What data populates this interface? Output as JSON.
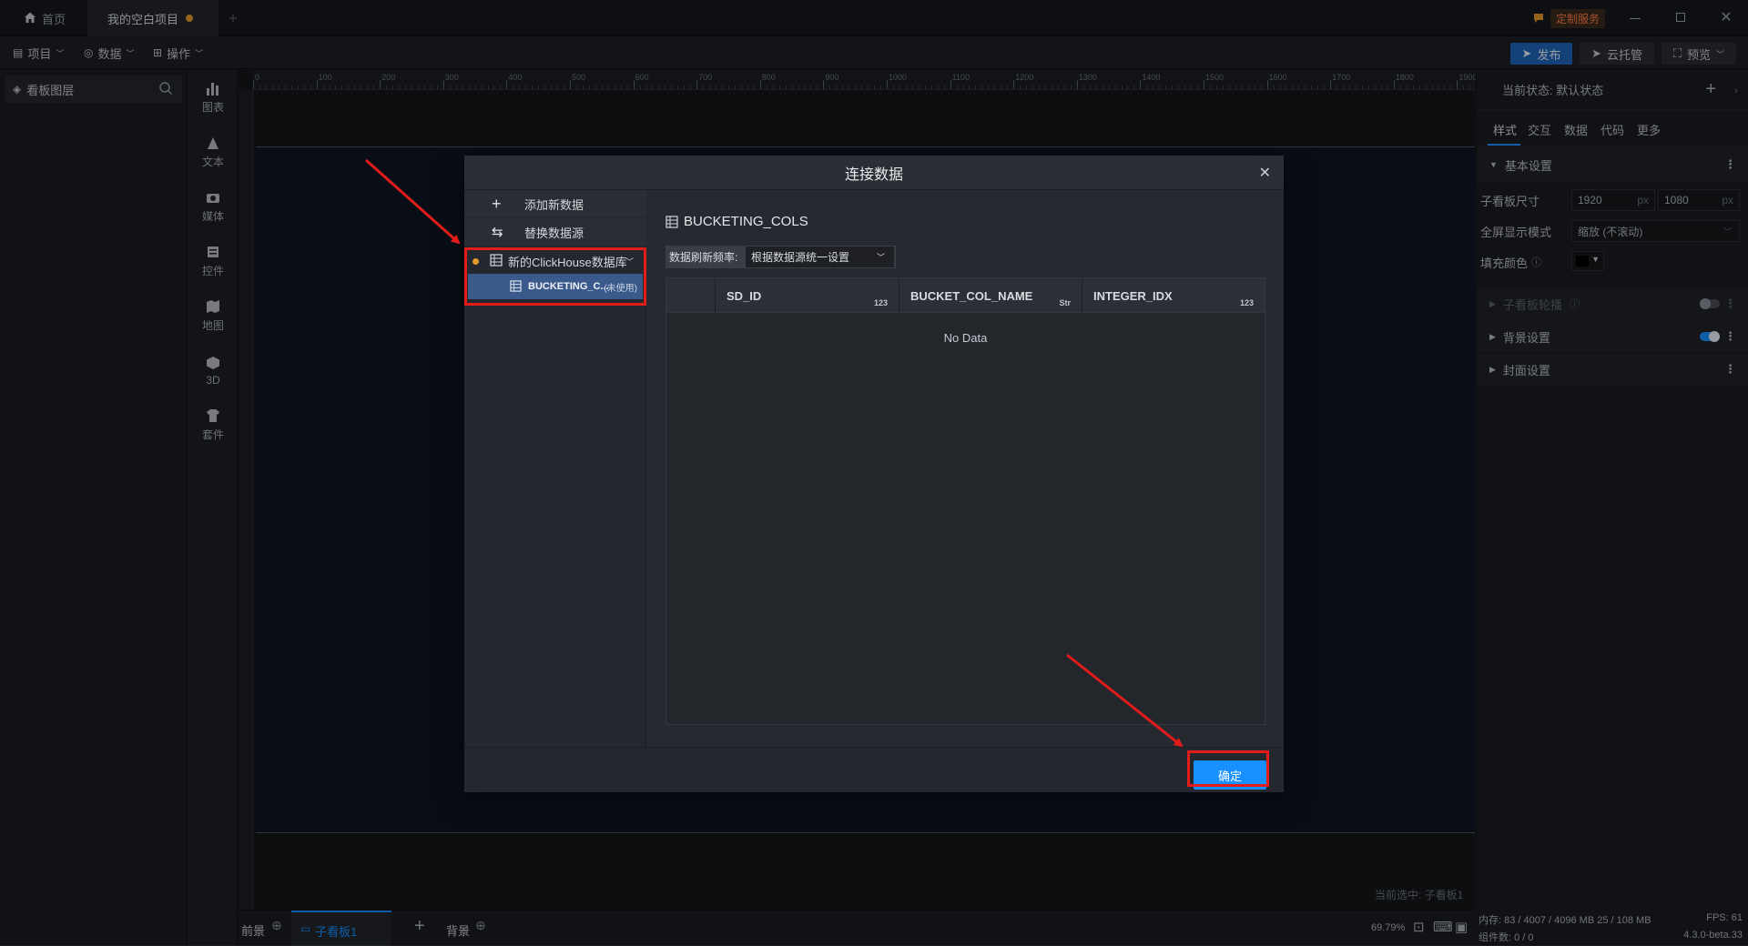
{
  "titlebar": {
    "home_tab": "首页",
    "project_tab": "我的空白项目",
    "custom_service": "定制服务"
  },
  "menubar": {
    "project": "项目",
    "data": "数据",
    "operation": "操作",
    "publish": "发布",
    "cloud": "云托管",
    "preview": "预览"
  },
  "layer_panel": {
    "title": "看板图层"
  },
  "components": [
    "图表",
    "文本",
    "媒体",
    "控件",
    "地图",
    "3D",
    "套件"
  ],
  "ruler": {
    "top_ticks": [
      "0",
      "100",
      "200",
      "300",
      "400",
      "500",
      "600",
      "700",
      "800",
      "900",
      "1000",
      "1100",
      "1200",
      "1300",
      "1400",
      "1500",
      "1600",
      "1700",
      "1800",
      "1900"
    ]
  },
  "right_panel": {
    "state_label": "当前状态: 默认状态",
    "tabs": [
      "样式",
      "交互",
      "数据",
      "代码",
      "更多"
    ],
    "basic_settings": "基本设置",
    "size_label": "子看板尺寸",
    "width_value": "1920",
    "height_value": "1080",
    "unit": "px",
    "fullscreen_label": "全屏显示模式",
    "fullscreen_value": "缩放 (不滚动)",
    "fill_label": "填充颜色",
    "sub_outline": "子看板轮播",
    "bg_settings": "背景设置",
    "cover_settings": "封面设置"
  },
  "bottom": {
    "front": "前景",
    "sub_board": "子看板1",
    "background": "背景",
    "zoom": "69.79%",
    "selected": "当前选中: 子看板1"
  },
  "status": {
    "memory": "内存: 83 / 4007 / 4096 MB  25 / 108 MB",
    "fps": "FPS: 61",
    "components": "组件数: 0 / 0",
    "version": "4.3.0-beta.33"
  },
  "modal": {
    "title": "连接数据",
    "add_data": "添加新数据",
    "replace_source": "替换数据源",
    "db_name": "新的ClickHouse数据库",
    "table_short": "BUCKETING_C...",
    "unused": "(未使用)",
    "table_title": "BUCKETING_COLS",
    "refresh_label": "数据刷新频率:",
    "refresh_value": "根据数据源统一设置",
    "columns": [
      {
        "name": "SD_ID",
        "type": "123"
      },
      {
        "name": "BUCKET_COL_NAME",
        "type": "Str"
      },
      {
        "name": "INTEGER_IDX",
        "type": "123"
      }
    ],
    "no_data": "No Data",
    "confirm": "确定"
  },
  "colors": {
    "accent": "#1890ff",
    "annotation": "#e21b1b",
    "warning": "#e39a2b"
  }
}
